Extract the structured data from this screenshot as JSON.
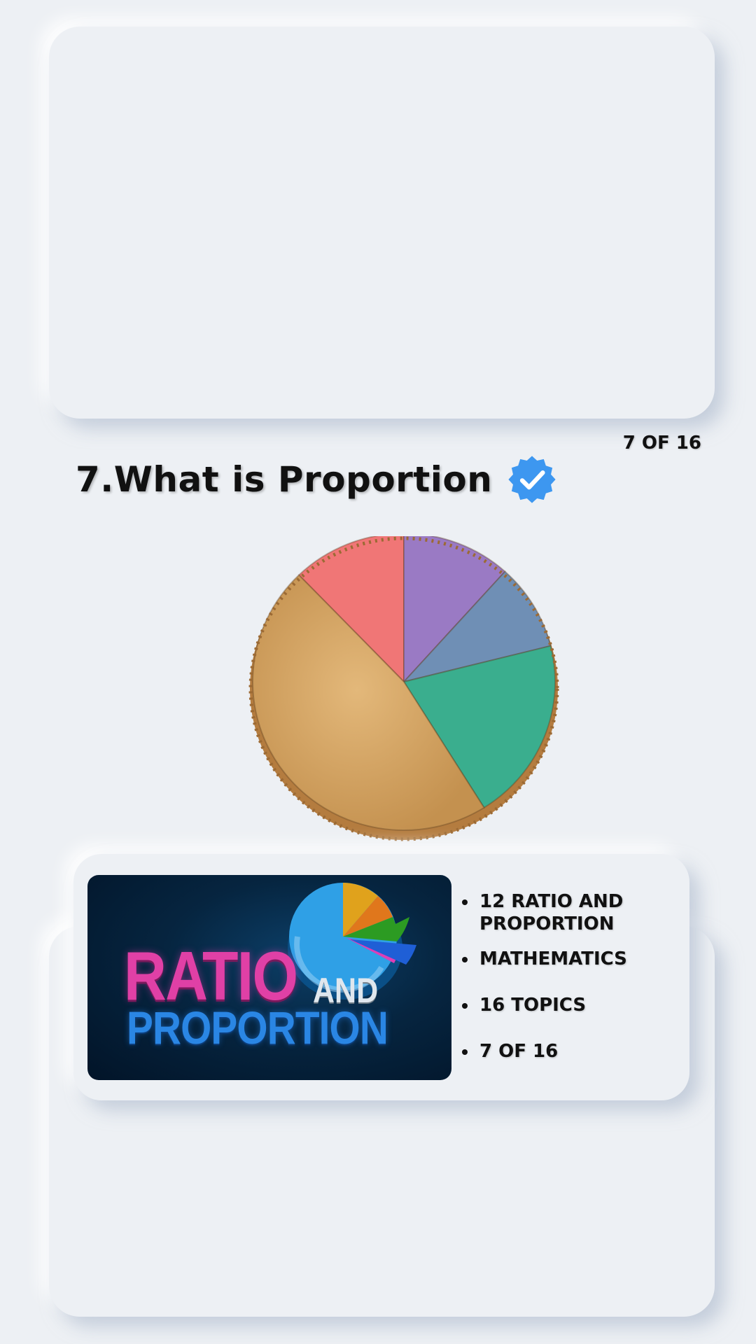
{
  "header": {
    "page_counter": "7 OF 16"
  },
  "main": {
    "title": "7.What is Proportion",
    "verified_icon": "verified-badge-icon",
    "pie_image": {
      "slice_colors": [
        "#f07676",
        "#9a7ac4",
        "#6f8fb5",
        "#3aae8e",
        "#d7a869"
      ]
    }
  },
  "info": {
    "banner": {
      "ratio": "RATIO",
      "and": "AND",
      "proportion": "PROPORTION"
    },
    "items": [
      "12 RATIO AND PROPORTION",
      "MATHEMATICS",
      "16 TOPICS",
      "7 OF 16"
    ]
  },
  "colors": {
    "background": "#edf0f4",
    "badge": "#3d97f0"
  }
}
